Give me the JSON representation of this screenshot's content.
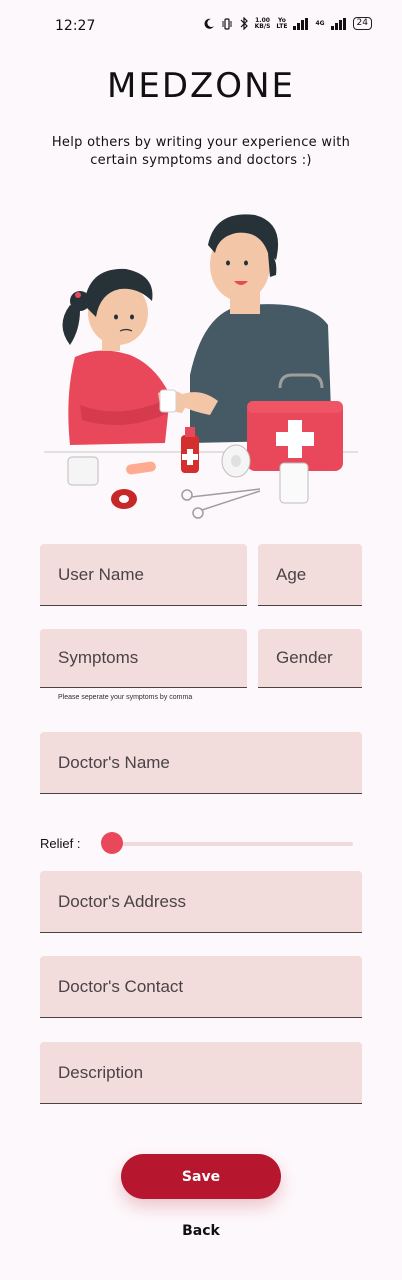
{
  "status_bar": {
    "time": "12:27",
    "net_speed_top": "1.00",
    "net_speed_bottom": "KB/S",
    "volte_top": "Yo",
    "volte_bottom": "LTE",
    "network": "4G",
    "battery": "24"
  },
  "app_title": "MEDZONE",
  "subtitle": "Help others by writing your experience with certain symptoms and doctors :)",
  "illustration": {
    "icon": "doctor-helping-girl-illustration"
  },
  "form": {
    "user_name_label": "User Name",
    "age_label": "Age",
    "symptoms_label": "Symptoms",
    "gender_label": "Gender",
    "symptoms_helper": "Please seperate your symptoms by comma",
    "doctor_name_label": "Doctor's Name",
    "relief_label": "Relief :",
    "relief_value": 0,
    "doctor_address_label": "Doctor's Address",
    "doctor_contact_label": "Doctor's Contact",
    "description_label": "Description"
  },
  "actions": {
    "save_label": "Save",
    "back_label": "Back"
  },
  "colors": {
    "field_bg": "#f3dcdc",
    "accent": "#e8485a",
    "save_bg": "#b7162f"
  }
}
